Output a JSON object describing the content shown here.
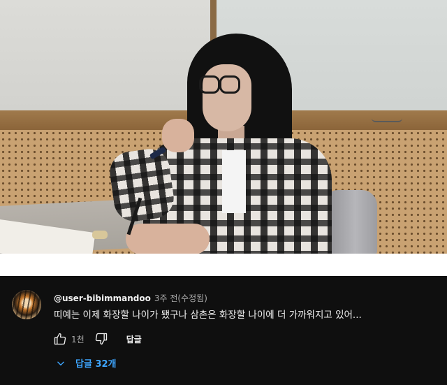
{
  "video": {
    "description_icon": "video-frame"
  },
  "comment": {
    "author": "@user-bibimmandoo",
    "time": "3주 전(수정됨)",
    "text": "띠예는 이제 화장할 나이가 됐구나 삼촌은 화장할 나이에 더 가까워지고 있어...",
    "likes": "1천",
    "reply_label": "답글",
    "replies_label": "답글 32개",
    "icons": {
      "like": "thumbs-up-icon",
      "dislike": "thumbs-down-icon",
      "toggle": "chevron-down-icon"
    },
    "colors": {
      "background": "#0f0f0f",
      "text": "#f1f1f1",
      "secondary": "#aaaaaa",
      "link": "#3ea6ff"
    }
  }
}
